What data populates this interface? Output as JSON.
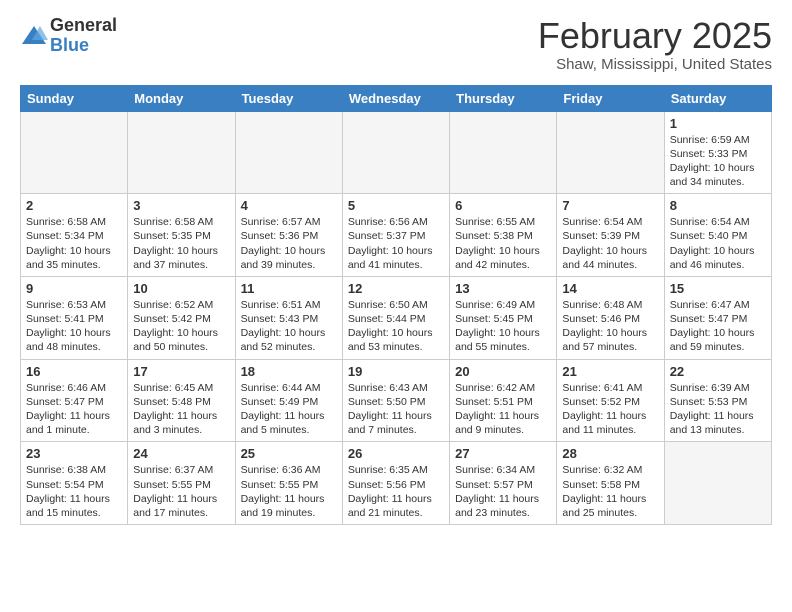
{
  "logo": {
    "general": "General",
    "blue": "Blue"
  },
  "title": "February 2025",
  "subtitle": "Shaw, Mississippi, United States",
  "days_of_week": [
    "Sunday",
    "Monday",
    "Tuesday",
    "Wednesday",
    "Thursday",
    "Friday",
    "Saturday"
  ],
  "weeks": [
    [
      {
        "num": "",
        "info": ""
      },
      {
        "num": "",
        "info": ""
      },
      {
        "num": "",
        "info": ""
      },
      {
        "num": "",
        "info": ""
      },
      {
        "num": "",
        "info": ""
      },
      {
        "num": "",
        "info": ""
      },
      {
        "num": "1",
        "info": "Sunrise: 6:59 AM\nSunset: 5:33 PM\nDaylight: 10 hours\nand 34 minutes."
      }
    ],
    [
      {
        "num": "2",
        "info": "Sunrise: 6:58 AM\nSunset: 5:34 PM\nDaylight: 10 hours\nand 35 minutes."
      },
      {
        "num": "3",
        "info": "Sunrise: 6:58 AM\nSunset: 5:35 PM\nDaylight: 10 hours\nand 37 minutes."
      },
      {
        "num": "4",
        "info": "Sunrise: 6:57 AM\nSunset: 5:36 PM\nDaylight: 10 hours\nand 39 minutes."
      },
      {
        "num": "5",
        "info": "Sunrise: 6:56 AM\nSunset: 5:37 PM\nDaylight: 10 hours\nand 41 minutes."
      },
      {
        "num": "6",
        "info": "Sunrise: 6:55 AM\nSunset: 5:38 PM\nDaylight: 10 hours\nand 42 minutes."
      },
      {
        "num": "7",
        "info": "Sunrise: 6:54 AM\nSunset: 5:39 PM\nDaylight: 10 hours\nand 44 minutes."
      },
      {
        "num": "8",
        "info": "Sunrise: 6:54 AM\nSunset: 5:40 PM\nDaylight: 10 hours\nand 46 minutes."
      }
    ],
    [
      {
        "num": "9",
        "info": "Sunrise: 6:53 AM\nSunset: 5:41 PM\nDaylight: 10 hours\nand 48 minutes."
      },
      {
        "num": "10",
        "info": "Sunrise: 6:52 AM\nSunset: 5:42 PM\nDaylight: 10 hours\nand 50 minutes."
      },
      {
        "num": "11",
        "info": "Sunrise: 6:51 AM\nSunset: 5:43 PM\nDaylight: 10 hours\nand 52 minutes."
      },
      {
        "num": "12",
        "info": "Sunrise: 6:50 AM\nSunset: 5:44 PM\nDaylight: 10 hours\nand 53 minutes."
      },
      {
        "num": "13",
        "info": "Sunrise: 6:49 AM\nSunset: 5:45 PM\nDaylight: 10 hours\nand 55 minutes."
      },
      {
        "num": "14",
        "info": "Sunrise: 6:48 AM\nSunset: 5:46 PM\nDaylight: 10 hours\nand 57 minutes."
      },
      {
        "num": "15",
        "info": "Sunrise: 6:47 AM\nSunset: 5:47 PM\nDaylight: 10 hours\nand 59 minutes."
      }
    ],
    [
      {
        "num": "16",
        "info": "Sunrise: 6:46 AM\nSunset: 5:47 PM\nDaylight: 11 hours\nand 1 minute."
      },
      {
        "num": "17",
        "info": "Sunrise: 6:45 AM\nSunset: 5:48 PM\nDaylight: 11 hours\nand 3 minutes."
      },
      {
        "num": "18",
        "info": "Sunrise: 6:44 AM\nSunset: 5:49 PM\nDaylight: 11 hours\nand 5 minutes."
      },
      {
        "num": "19",
        "info": "Sunrise: 6:43 AM\nSunset: 5:50 PM\nDaylight: 11 hours\nand 7 minutes."
      },
      {
        "num": "20",
        "info": "Sunrise: 6:42 AM\nSunset: 5:51 PM\nDaylight: 11 hours\nand 9 minutes."
      },
      {
        "num": "21",
        "info": "Sunrise: 6:41 AM\nSunset: 5:52 PM\nDaylight: 11 hours\nand 11 minutes."
      },
      {
        "num": "22",
        "info": "Sunrise: 6:39 AM\nSunset: 5:53 PM\nDaylight: 11 hours\nand 13 minutes."
      }
    ],
    [
      {
        "num": "23",
        "info": "Sunrise: 6:38 AM\nSunset: 5:54 PM\nDaylight: 11 hours\nand 15 minutes."
      },
      {
        "num": "24",
        "info": "Sunrise: 6:37 AM\nSunset: 5:55 PM\nDaylight: 11 hours\nand 17 minutes."
      },
      {
        "num": "25",
        "info": "Sunrise: 6:36 AM\nSunset: 5:55 PM\nDaylight: 11 hours\nand 19 minutes."
      },
      {
        "num": "26",
        "info": "Sunrise: 6:35 AM\nSunset: 5:56 PM\nDaylight: 11 hours\nand 21 minutes."
      },
      {
        "num": "27",
        "info": "Sunrise: 6:34 AM\nSunset: 5:57 PM\nDaylight: 11 hours\nand 23 minutes."
      },
      {
        "num": "28",
        "info": "Sunrise: 6:32 AM\nSunset: 5:58 PM\nDaylight: 11 hours\nand 25 minutes."
      },
      {
        "num": "",
        "info": ""
      }
    ]
  ]
}
